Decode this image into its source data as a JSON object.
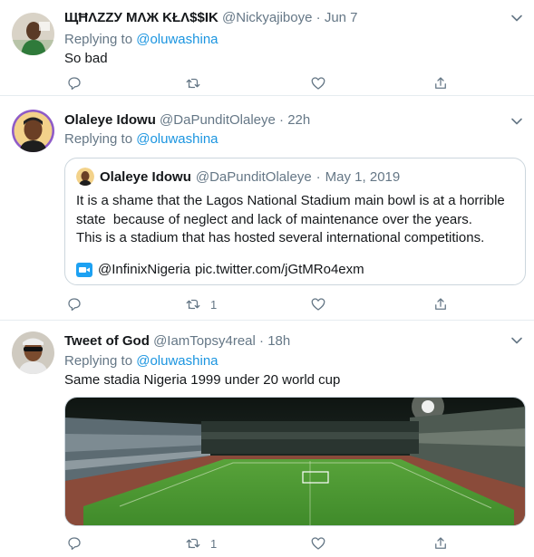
{
  "tweets": [
    {
      "name": "ЩĦΛZZУ МΛЖ ΚŁΛ$$IΚ",
      "handle": "@Nickyajiboye",
      "dot": "·",
      "time": "Jun 7",
      "reply_prefix": "Replying to",
      "reply_to": "@oluwashina",
      "text": "So bad",
      "retweets": "",
      "likes": ""
    },
    {
      "name": "Olaleye Idowu",
      "handle": "@DaPunditOlaleye",
      "dot": "·",
      "time": "22h",
      "reply_prefix": "Replying to",
      "reply_to": "@oluwashina",
      "retweets": "1",
      "likes": "",
      "quote": {
        "name": "Olaleye Idowu",
        "handle": "@DaPunditOlaleye",
        "dot": "·",
        "time": "May 1, 2019",
        "line1": "It is a shame that the Lagos National Stadium main bowl is at a horrible",
        "line2": "state  because of neglect and lack of maintenance over the years.",
        "line3": "This is a stadium that has hosted several international competitions.",
        "link_mention": "@InfinixNigeria",
        "link_url": "pic.twitter.com/jGtMRo4exm"
      }
    },
    {
      "name": "Tweet of God",
      "handle": "@IamTopsy4real",
      "dot": "·",
      "time": "18h",
      "reply_prefix": "Replying to",
      "reply_to": "@oluwashina",
      "text": "Same stadia Nigeria 1999 under 20 world cup",
      "retweets": "1",
      "likes": ""
    }
  ],
  "colors": {
    "text": "#14171a",
    "secondary": "#657786",
    "link": "#1b95e0",
    "border": "#e6ecf0"
  }
}
